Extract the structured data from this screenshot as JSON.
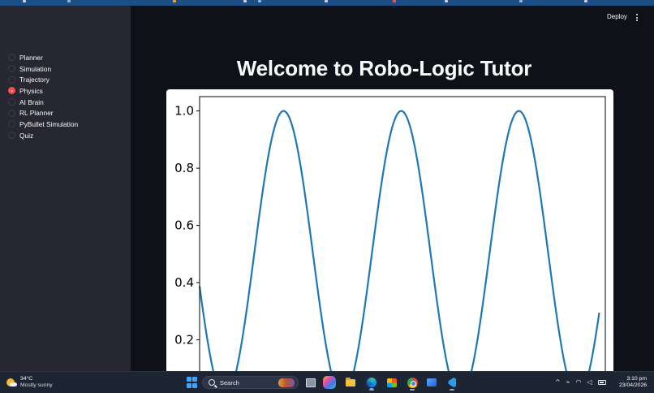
{
  "sidebar": {
    "nav_items": [
      {
        "label": "Planner",
        "selected": false
      },
      {
        "label": "Simulation",
        "selected": false
      },
      {
        "label": "Trajectory",
        "selected": false
      },
      {
        "label": "Physics",
        "selected": true
      },
      {
        "label": "AI Brain",
        "selected": false
      },
      {
        "label": "RL Planner",
        "selected": false
      },
      {
        "label": "PyBullet Simulation",
        "selected": false
      },
      {
        "label": "Quiz",
        "selected": false
      }
    ]
  },
  "header": {
    "deploy_label": "Deploy",
    "menu_icon": "more-vertical-icon"
  },
  "main": {
    "title": "Welcome to Robo-Logic Tutor"
  },
  "chart_data": {
    "type": "line",
    "title": "",
    "xlabel": "",
    "ylabel": "",
    "y_ticks": [
      "0.2",
      "0.4",
      "0.6",
      "0.8",
      "1.0"
    ],
    "ylim": [
      0,
      1.05
    ],
    "x_range": [
      0,
      100
    ],
    "series": [
      {
        "formula": "sin(t)^2 sampled over ~3.2 periods",
        "color": "#1f77b4",
        "peaks_x": [
          20.7,
          49.7,
          78.7
        ],
        "troughs_x": [
          35.2,
          64.2,
          93.2
        ],
        "end_y": 0.3
      }
    ],
    "grid": false,
    "legend": "none"
  },
  "taskbar": {
    "weather": {
      "temp": "34°C",
      "desc": "Mostly sunny",
      "icon": "partly-sunny-icon"
    },
    "search_placeholder": "Search",
    "pinned": [
      "start-icon",
      "task-view-icon",
      "copilot-icon",
      "file-explorer-icon",
      "edge-icon",
      "store-icon",
      "chrome-icon",
      "photos-icon",
      "vscode-icon"
    ],
    "tray": {
      "chevron": "^",
      "wifi": "wifi-icon",
      "volume": "volume-icon",
      "battery": "battery-icon"
    },
    "clock": {
      "time": "3:10 pm",
      "date": "23/04/2026"
    }
  },
  "colors": {
    "sidebar_bg": "#262730",
    "main_bg": "#0e1117",
    "accent": "#ff4b4b",
    "line": "#1f77b4",
    "taskbar_bg": "#1d2533"
  }
}
